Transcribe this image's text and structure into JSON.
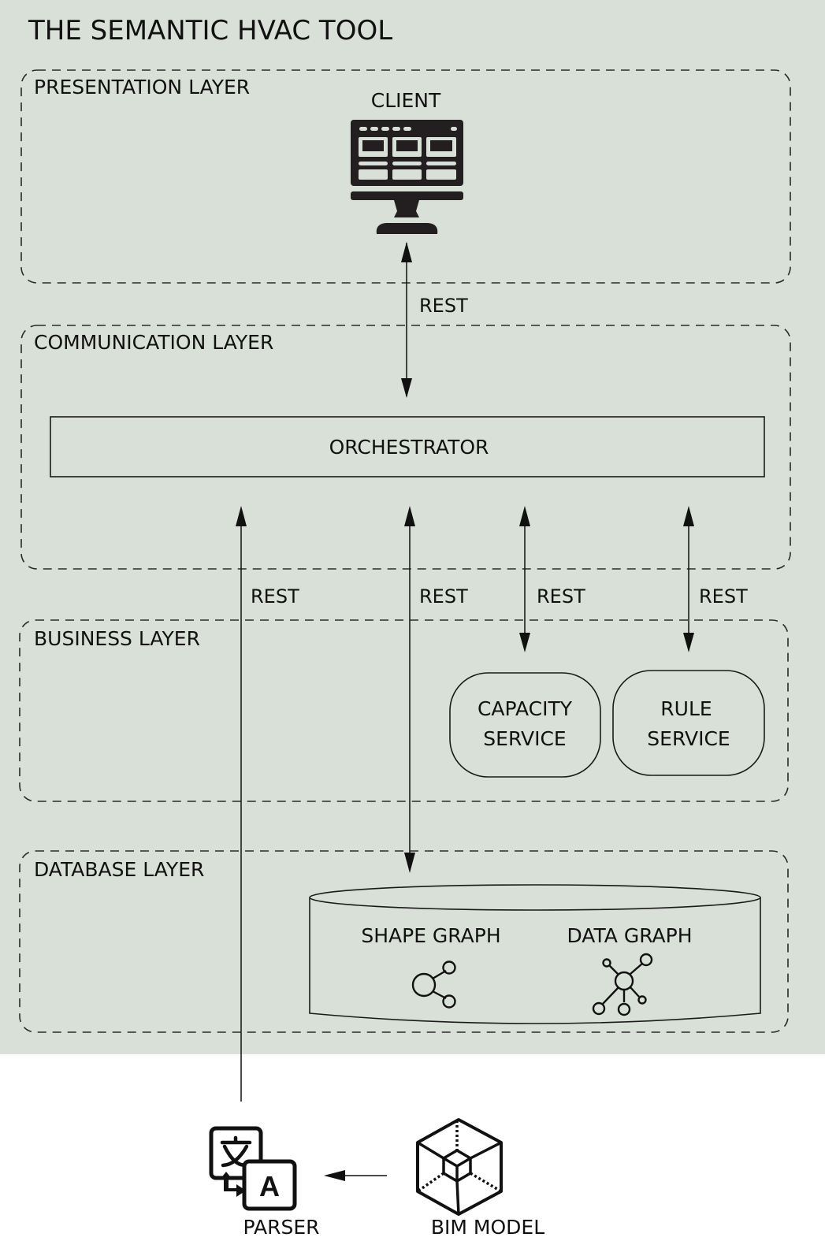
{
  "title": "THE SEMANTIC HVAC TOOL",
  "layers": {
    "presentation": "PRESENTATION LAYER",
    "communication": "COMMUNICATION LAYER",
    "business": "BUSINESS LAYER",
    "database": "DATABASE LAYER"
  },
  "components": {
    "client": "CLIENT",
    "orchestrator": "ORCHESTRATOR",
    "capacity_service": [
      "CAPACITY",
      "SERVICE"
    ],
    "rule_service": [
      "RULE",
      "SERVICE"
    ],
    "shape_graph": "SHAPE GRAPH",
    "data_graph": "DATA GRAPH",
    "parser": "PARSER",
    "bim_model": "BIM MODEL"
  },
  "connections": [
    {
      "from": "client",
      "to": "orchestrator",
      "label": "REST",
      "direction": "bidirectional"
    },
    {
      "from": "parser",
      "to": "orchestrator",
      "label": "REST",
      "direction": "one-way"
    },
    {
      "from": "orchestrator",
      "to": "database",
      "label": "REST",
      "direction": "bidirectional"
    },
    {
      "from": "orchestrator",
      "to": "capacity_service",
      "label": "REST",
      "direction": "bidirectional"
    },
    {
      "from": "orchestrator",
      "to": "rule_service",
      "label": "REST",
      "direction": "bidirectional"
    },
    {
      "from": "bim_model",
      "to": "parser",
      "label": "",
      "direction": "one-way"
    }
  ],
  "colors": {
    "panel_background": "#d9e0d7",
    "ink": "#231f20"
  }
}
